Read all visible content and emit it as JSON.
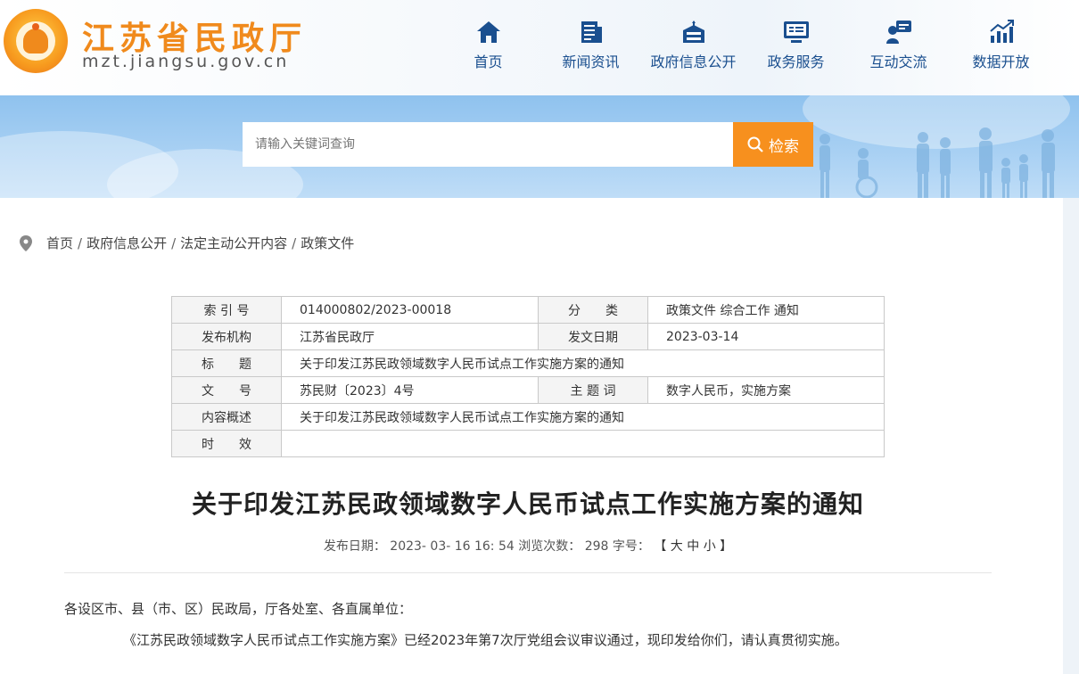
{
  "header": {
    "site_title": "江苏省民政厅",
    "site_domain": "mzt.jiangsu.gov.cn"
  },
  "nav": [
    {
      "label": "首页",
      "icon": "home-icon"
    },
    {
      "label": "新闻资讯",
      "icon": "news-icon"
    },
    {
      "label": "政府信息公开",
      "icon": "bank-icon"
    },
    {
      "label": "政务服务",
      "icon": "monitor-icon"
    },
    {
      "label": "互动交流",
      "icon": "interaction-icon"
    },
    {
      "label": "数据开放",
      "icon": "chart-icon"
    }
  ],
  "search": {
    "placeholder": "请输入关键词查询",
    "button_label": "检索"
  },
  "breadcrumb": [
    "首页",
    "政府信息公开",
    "法定主动公开内容",
    "政策文件"
  ],
  "meta": {
    "index_label": "索 引 号",
    "index_value": "014000802/2023-00018",
    "category_label": "分　　类",
    "category_value": "政策文件 综合工作 通知",
    "issuer_label": "发布机构",
    "issuer_value": "江苏省民政厅",
    "date_label": "发文日期",
    "date_value": "2023-03-14",
    "title_label": "标　　题",
    "title_value": "关于印发江苏民政领域数字人民币试点工作实施方案的通知",
    "docno_label": "文　　号",
    "docno_value": "苏民财〔2023〕4号",
    "keywords_label": "主 题 词",
    "keywords_value": "数字人民币，实施方案",
    "summary_label": "内容概述",
    "summary_value": "关于印发江苏民政领域数字人民币试点工作实施方案的通知",
    "validity_label": "时　　效",
    "validity_value": ""
  },
  "article": {
    "title": "关于印发江苏民政领域数字人民币试点工作实施方案的通知",
    "publish_label": "发布日期：",
    "publish_value": "2023- 03- 16 16: 54",
    "views_label": "浏览次数：",
    "views_value": "298",
    "fontsize_label": "字号：",
    "fontsize_open": "【",
    "fontsize_large": "大",
    "fontsize_medium": "中",
    "fontsize_small": "小",
    "fontsize_close": "】",
    "para1": "各设区市、县（市、区）民政局，厅各处室、各直属单位：",
    "para2": "《江苏民政领域数字人民币试点工作实施方案》已经2023年第7次厅党组会议审议通过，现印发给你们，请认真贯彻实施。"
  },
  "colors": {
    "nav_blue": "#1a4f8f",
    "accent_orange": "#f7901e",
    "banner_blue": "#a8d0f3"
  }
}
